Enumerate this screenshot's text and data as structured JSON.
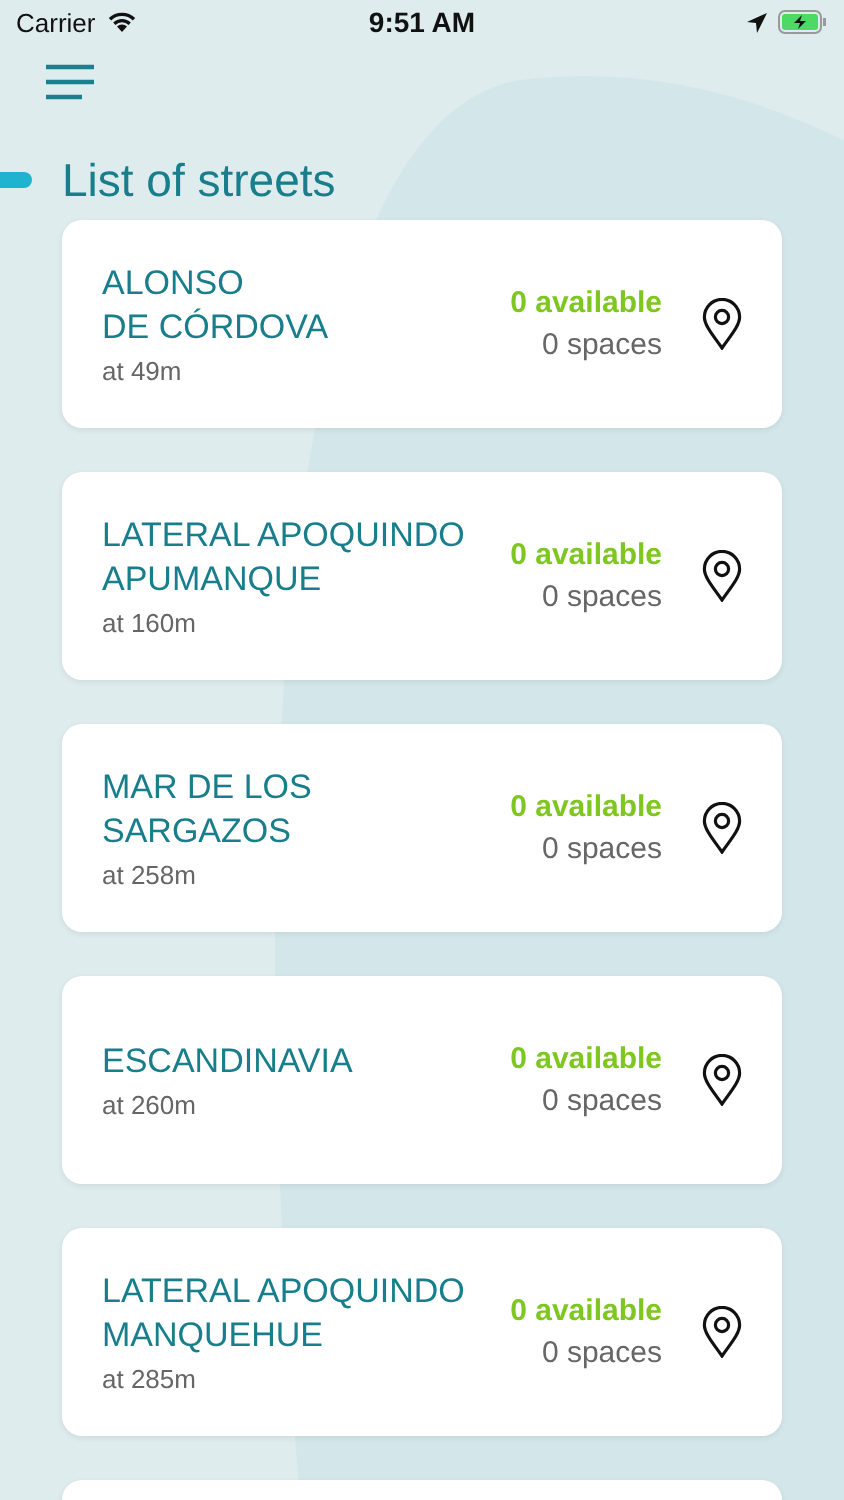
{
  "status_bar": {
    "carrier": "Carrier",
    "time": "9:51 AM"
  },
  "title": "List of streets",
  "streets": [
    {
      "name": "ALONSO\nDE CÓRDOVA",
      "distance": "at 49m",
      "available": "0 available",
      "spaces": "0 spaces"
    },
    {
      "name": "LATERAL APOQUINDO\nAPUMANQUE",
      "distance": "at 160m",
      "available": "0 available",
      "spaces": "0 spaces"
    },
    {
      "name": "MAR DE LOS\nSARGAZOS",
      "distance": "at 258m",
      "available": "0 available",
      "spaces": "0 spaces"
    },
    {
      "name": "ESCANDINAVIA",
      "distance": "at 260m",
      "available": "0 available",
      "spaces": "0 spaces"
    },
    {
      "name": "LATERAL APOQUINDO\nMANQUEHUE",
      "distance": "at 285m",
      "available": "0 available",
      "spaces": "0 spaces"
    }
  ]
}
